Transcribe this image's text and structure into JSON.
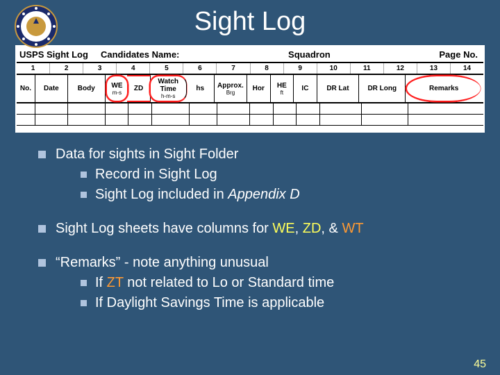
{
  "title": "Sight Log",
  "header": {
    "left": "USPS Sight Log",
    "cand": "Candidates Name:",
    "sq": "Squadron",
    "pg": "Page No."
  },
  "nums": [
    "1",
    "2",
    "3",
    "4",
    "5",
    "6",
    "7",
    "8",
    "9",
    "10",
    "11",
    "12",
    "13",
    "14"
  ],
  "cols": {
    "no": "No.",
    "date": "Date",
    "body": "Body",
    "we": "WE",
    "we_sub": "m-s",
    "zd": "ZD",
    "wt": "Watch Time",
    "wt_sub": "h-m-s",
    "hs": "hs",
    "brg": "Approx.",
    "brg_sub": "Brg",
    "hor": "Hor",
    "he": "HE",
    "he_sub": "ft",
    "ic": "IC",
    "drlat": "DR Lat",
    "drlong": "DR Long",
    "rem": "Remarks"
  },
  "bullets": {
    "b1": "Data for sights in Sight Folder",
    "b1a": "Record in Sight Log",
    "b1b_pre": "Sight Log included in ",
    "b1b_em": "Appendix D",
    "b2_pre": "Sight Log sheets have columns for ",
    "b2_we": "WE",
    "b2_sep1": ", ",
    "b2_zd": "ZD",
    "b2_sep2": ", & ",
    "b2_wt": "WT",
    "b3": "“Remarks” - note anything unusual",
    "b3a_pre": "If ",
    "b3a_zt": "ZT",
    "b3a_post": " not related to Lo or Standard time",
    "b3b": "If Daylight Savings Time is applicable"
  },
  "pagenum": "45"
}
